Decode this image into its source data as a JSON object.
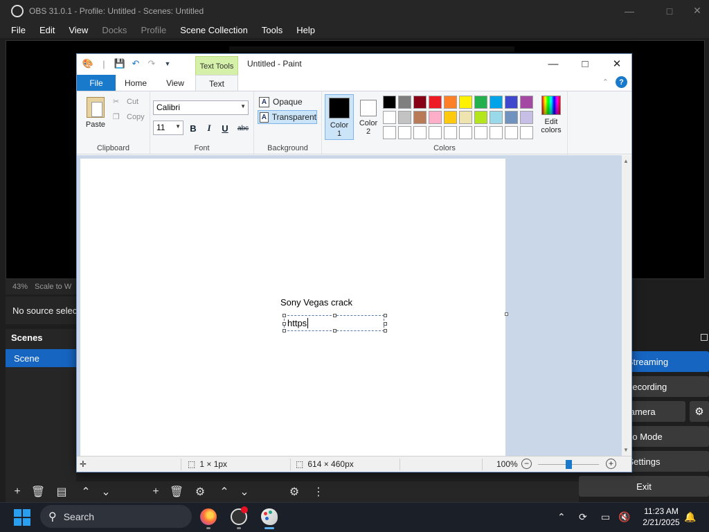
{
  "obs": {
    "title": "OBS 31.0.1 - Profile: Untitled - Scenes: Untitled",
    "menu": [
      "File",
      "Edit",
      "View",
      "Docks",
      "Profile",
      "Scene Collection",
      "Tools",
      "Help"
    ],
    "zoom_label": "43%",
    "scale_label": "Scale to W",
    "no_source": "No source selec",
    "scenes_title": "Scenes",
    "scene_item": "Scene",
    "controls": {
      "streaming": "o Streaming",
      "recording": "t Recording",
      "virtual_camera": "ual Camera",
      "studio_mode": "dio Mode",
      "settings": "Settings",
      "exit": "Exit"
    }
  },
  "paint": {
    "title": "Untitled - Paint",
    "contextual_tab": "Text Tools",
    "tabs": {
      "file": "File",
      "home": "Home",
      "view": "View",
      "text": "Text"
    },
    "clipboard": {
      "paste": "Paste",
      "cut": "Cut",
      "copy": "Copy",
      "label": "Clipboard"
    },
    "font": {
      "family": "Calibri",
      "size": "11",
      "bold": "B",
      "italic": "I",
      "underline": "U",
      "strike": "abc",
      "label": "Font"
    },
    "background": {
      "opaque": "Opaque",
      "transparent": "Transparent",
      "label": "Background"
    },
    "colors": {
      "color1_line1": "Color",
      "color1_line2": "1",
      "color2_line1": "Color",
      "color2_line2": "2",
      "edit_line1": "Edit",
      "edit_line2": "colors",
      "label": "Colors",
      "color1": "#000000",
      "color2": "#ffffff",
      "palette_row1": [
        "#000000",
        "#7f7f7f",
        "#880015",
        "#ed1c24",
        "#ff7f27",
        "#fff200",
        "#22b14c",
        "#00a2e8",
        "#3f48cc",
        "#a349a4"
      ],
      "palette_row2": [
        "#ffffff",
        "#c3c3c3",
        "#b97a57",
        "#ffaec9",
        "#ffc90e",
        "#efe4b0",
        "#b5e61d",
        "#99d9ea",
        "#7092be",
        "#c8bfe7"
      ],
      "palette_row3": [
        "#ffffff",
        "#ffffff",
        "#ffffff",
        "#ffffff",
        "#ffffff",
        "#ffffff",
        "#ffffff",
        "#ffffff",
        "#ffffff",
        "#ffffff"
      ]
    },
    "canvas": {
      "text_line": "Sony Vegas crack",
      "textbox_text": "https"
    },
    "status": {
      "selection": "1 × 1px",
      "size": "614 × 460px",
      "zoom": "100%"
    }
  },
  "taskbar": {
    "search": "Search",
    "time": "11:23 AM",
    "date": "2/21/2025"
  }
}
